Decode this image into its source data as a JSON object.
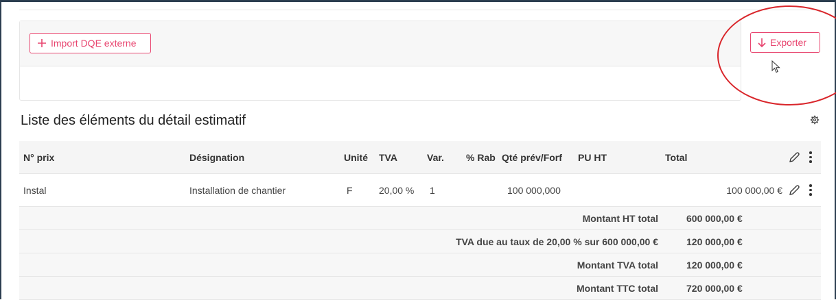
{
  "toolbar": {
    "import_label": "Import DQE externe",
    "export_label": "Exporter"
  },
  "section": {
    "title": "Liste des éléments du détail estimatif"
  },
  "table": {
    "headers": {
      "prix": "N° prix",
      "designation": "Désignation",
      "unite": "Unité",
      "tva": "TVA",
      "var": "Var.",
      "rab": "% Rab",
      "qte": "Qté prév/Forf",
      "pu": "PU HT",
      "total": "Total"
    },
    "rows": [
      {
        "prix": "Instal",
        "designation": "Installation de chantier",
        "unite": "F",
        "tva": "20,00 %",
        "var": "1",
        "rab": "",
        "qte": "100 000,000",
        "pu": "",
        "total": "100 000,00 €"
      }
    ],
    "summary": [
      {
        "label": "Montant HT total",
        "value": "600 000,00 €"
      },
      {
        "label": "TVA due au taux de 20,00 % sur 600 000,00 €",
        "value": "120 000,00 €"
      },
      {
        "label": "Montant TVA total",
        "value": "120 000,00 €"
      },
      {
        "label": "Montant TTC total",
        "value": "720 000,00 €"
      }
    ]
  },
  "icons": {
    "import": "plus-icon",
    "export": "arrow-down-icon",
    "settings": "gear-icon",
    "edit": "pencil-icon",
    "more": "kebab-menu-icon"
  },
  "colors": {
    "accent": "#e8456f",
    "annotation": "#d9262b",
    "header_bg": "#f5f5f5"
  }
}
